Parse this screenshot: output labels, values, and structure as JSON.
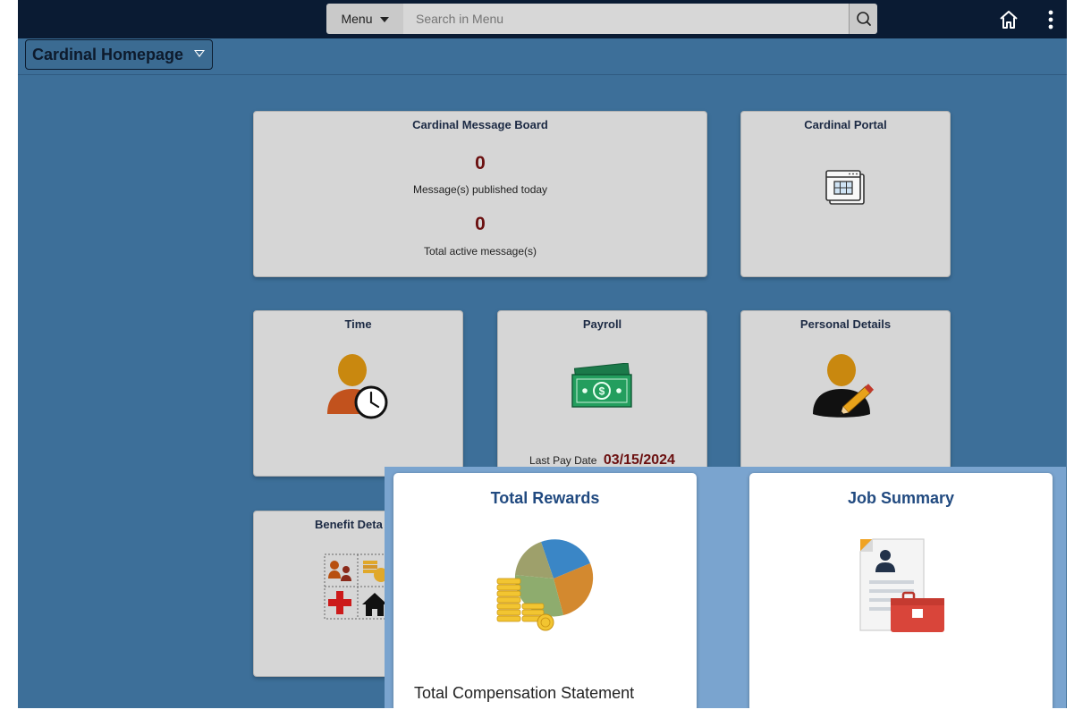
{
  "header": {
    "menu_label": "Menu",
    "search_placeholder": "Search in Menu",
    "home_icon": "home-icon",
    "more_icon": "vertical-dots-icon"
  },
  "page": {
    "title": "Cardinal Homepage"
  },
  "tiles": {
    "message_board": {
      "title": "Cardinal Message Board",
      "published_today_count": "0",
      "published_today_label": "Message(s) published today",
      "active_count": "0",
      "active_label": "Total active message(s)"
    },
    "portal": {
      "title": "Cardinal Portal",
      "icon": "portal-window-icon"
    },
    "time": {
      "title": "Time",
      "icon": "person-clock-icon"
    },
    "payroll": {
      "title": "Payroll",
      "icon": "cash-icon",
      "last_pay_label": "Last Pay Date",
      "last_pay_date": "03/15/2024"
    },
    "personal_details": {
      "title": "Personal Details",
      "icon": "person-pencil-icon"
    },
    "benefit_details": {
      "title": "Benefit Deta",
      "icon": "benefits-grid-icon"
    },
    "total_rewards": {
      "title": "Total Rewards",
      "footer": "Total Compensation Statement",
      "icon": "pie-coins-icon"
    },
    "job_summary": {
      "title": "Job Summary",
      "icon": "resume-briefcase-icon"
    }
  },
  "colors": {
    "page_background": "#3d6f99",
    "top_bar": "#0a1b33",
    "tile_background": "#d6d6d6",
    "message_count": "#6b1010",
    "popup_panel": "#7aa4cf",
    "popup_title": "#214a80"
  }
}
